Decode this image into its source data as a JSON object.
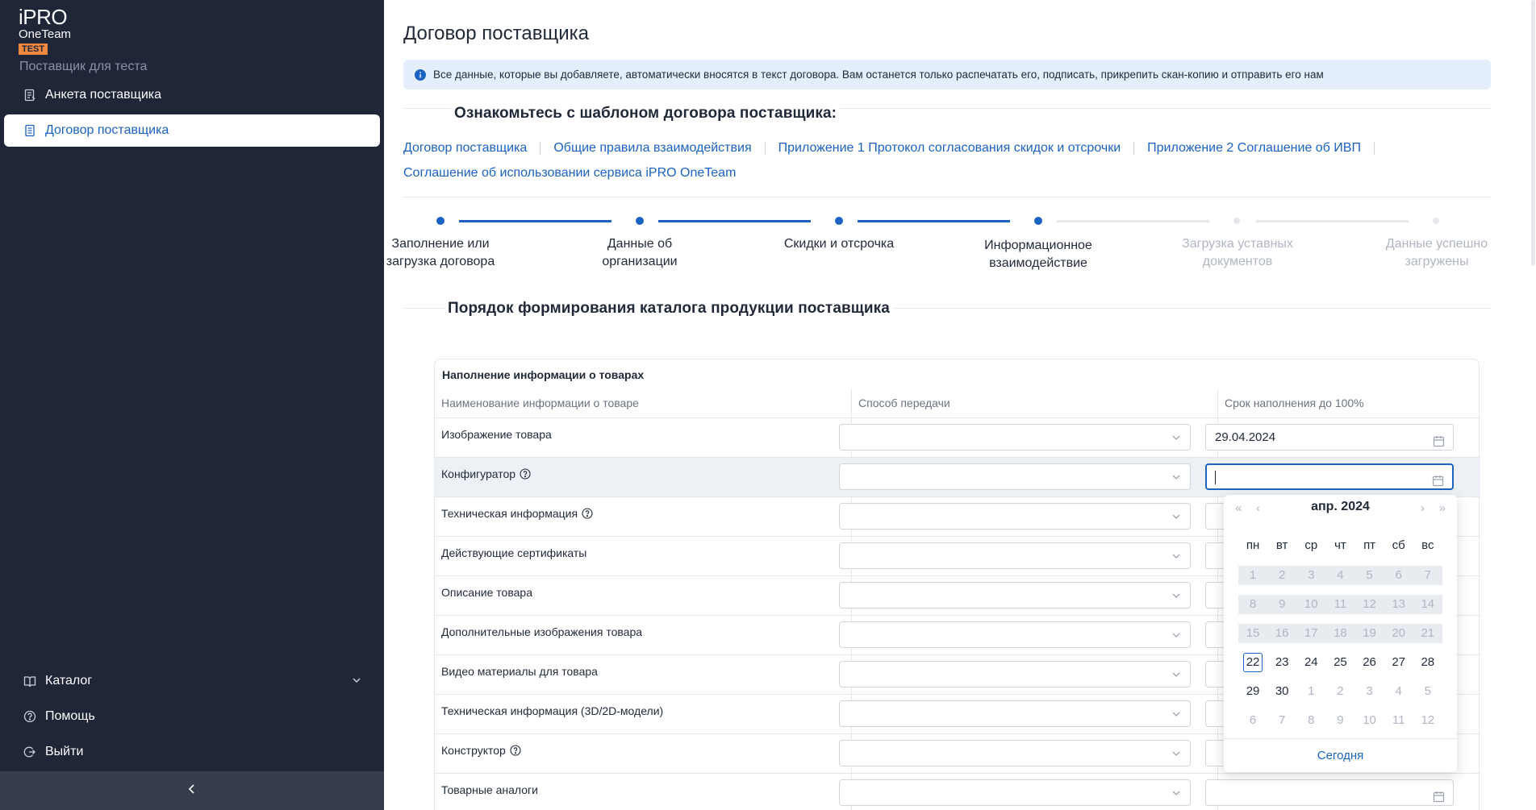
{
  "sidebar": {
    "logo": {
      "brand": "iPRO",
      "product": "OneTeam",
      "badge": "TEST"
    },
    "supplier_name": "Поставщик для теста",
    "top_items": [
      {
        "label": "Анкета поставщика",
        "icon": "form-icon"
      },
      {
        "label": "Договор поставщика",
        "icon": "document-icon"
      }
    ],
    "bottom_items": [
      {
        "label": "Каталог",
        "icon": "catalog-icon"
      },
      {
        "label": "Помощь",
        "icon": "help-icon"
      },
      {
        "label": "Выйти",
        "icon": "logout-icon"
      }
    ],
    "collapse_icon": "chevron-left-icon"
  },
  "main": {
    "title": "Договор поставщика",
    "info_banner": "Все данные, которые вы добавляете, автоматически вносятся в текст договора. Вам останется только распечатать его, подписать, прикрепить скан-копию и отправить его нам",
    "template_title": "Ознакомьтесь с шаблоном договора поставщика:",
    "template_links": [
      "Договор поставщика",
      "Общие правила взаимодействия",
      "Приложение 1 Протокол согласования скидок и отсрочки",
      "Приложение 2 Соглашение об ИВП",
      "Соглашение об использовании сервиса iPRO OneTeam"
    ],
    "steps": [
      {
        "label_1": "Заполнение или",
        "label_2": "загрузка договора",
        "state": "done"
      },
      {
        "label_1": "Данные об",
        "label_2": "организации",
        "state": "done"
      },
      {
        "label_1": "Скидки и отсрочка",
        "label_2": "",
        "state": "done"
      },
      {
        "label_1": "Информационное",
        "label_2": "взаимодействие",
        "state": "current"
      },
      {
        "label_1": "Загрузка уставных",
        "label_2": "документов",
        "state": "pending"
      },
      {
        "label_1": "Данные успешно",
        "label_2": "загружены",
        "state": "pending"
      }
    ],
    "catalog_title": "Порядок формирования каталога продукции поставщика",
    "table": {
      "caption": "Наполнение информации о товарах",
      "headers": [
        "Наименование информации о товаре",
        "Способ передачи",
        "Срок наполнения до 100%"
      ],
      "rows": [
        {
          "name": "Изображение товара",
          "help": false,
          "method": "",
          "date": "29.04.2024"
        },
        {
          "name": "Конфигуратор",
          "help": true,
          "method": "",
          "date": ""
        },
        {
          "name": "Техническая информация",
          "help": true,
          "method": "",
          "date": ""
        },
        {
          "name": "Действующие сертификаты",
          "help": false,
          "method": "",
          "date": ""
        },
        {
          "name": "Описание товара",
          "help": false,
          "method": "",
          "date": ""
        },
        {
          "name": "Дополнительные изображения товара",
          "help": false,
          "method": "",
          "date": ""
        },
        {
          "name": "Видео материалы для товара",
          "help": false,
          "method": "",
          "date": ""
        },
        {
          "name": "Техническая информация (3D/2D-модели)",
          "help": false,
          "method": "",
          "date": ""
        },
        {
          "name": "Конструктор",
          "help": true,
          "method": "",
          "date": ""
        },
        {
          "name": "Товарные аналоги",
          "help": false,
          "method": "",
          "date": ""
        }
      ]
    }
  },
  "datepicker": {
    "title": "апр.  2024",
    "weekdays": [
      "пн",
      "вт",
      "ср",
      "чт",
      "пт",
      "сб",
      "вс"
    ],
    "weeks": [
      [
        [
          "1",
          "dis"
        ],
        [
          "2",
          "dis"
        ],
        [
          "3",
          "dis"
        ],
        [
          "4",
          "dis"
        ],
        [
          "5",
          "dis"
        ],
        [
          "6",
          "dis"
        ],
        [
          "7",
          "dis"
        ]
      ],
      [
        [
          "8",
          "dis"
        ],
        [
          "9",
          "dis"
        ],
        [
          "10",
          "dis"
        ],
        [
          "11",
          "dis"
        ],
        [
          "12",
          "dis"
        ],
        [
          "13",
          "dis"
        ],
        [
          "14",
          "dis"
        ]
      ],
      [
        [
          "15",
          "dis"
        ],
        [
          "16",
          "dis"
        ],
        [
          "17",
          "dis"
        ],
        [
          "18",
          "dis"
        ],
        [
          "19",
          "dis"
        ],
        [
          "20",
          "dis"
        ],
        [
          "21",
          "dis"
        ]
      ],
      [
        [
          "22",
          "today"
        ],
        [
          "23",
          ""
        ],
        [
          "24",
          ""
        ],
        [
          "25",
          ""
        ],
        [
          "26",
          ""
        ],
        [
          "27",
          ""
        ],
        [
          "28",
          ""
        ]
      ],
      [
        [
          "29",
          ""
        ],
        [
          "30",
          ""
        ],
        [
          "1",
          "other"
        ],
        [
          "2",
          "other"
        ],
        [
          "3",
          "other"
        ],
        [
          "4",
          "other"
        ],
        [
          "5",
          "other"
        ]
      ],
      [
        [
          "6",
          "other"
        ],
        [
          "7",
          "other"
        ],
        [
          "8",
          "other"
        ],
        [
          "9",
          "other"
        ],
        [
          "10",
          "other"
        ],
        [
          "11",
          "other"
        ],
        [
          "12",
          "other"
        ]
      ]
    ],
    "today_label": "Сегодня",
    "nav": {
      "prev_year": "«",
      "prev_month": "‹",
      "next_month": "›",
      "next_year": "»"
    }
  },
  "colors": {
    "sidebar_bg": "#1f2638",
    "accent": "#1b62c4",
    "step_pending": "#d1d5db",
    "banner_bg": "#e5effc",
    "badge": "#f0883e"
  }
}
